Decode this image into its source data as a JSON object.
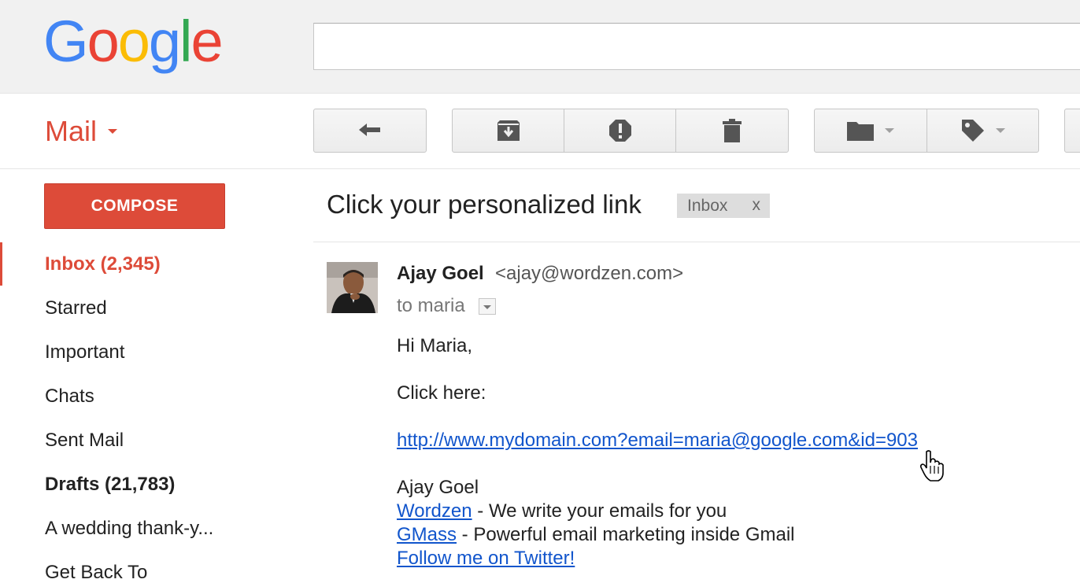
{
  "brand": {
    "logo_letters": [
      "G",
      "o",
      "o",
      "g",
      "l",
      "e"
    ],
    "logo_colors": [
      "#4285f4",
      "#ea4335",
      "#fbbc05",
      "#4285f4",
      "#34a853",
      "#ea4335"
    ],
    "accent": "#dd4b39",
    "link_color": "#1155cc"
  },
  "search": {
    "value": "",
    "placeholder": ""
  },
  "app_switcher": {
    "label": "Mail"
  },
  "toolbar": {
    "icons": [
      "reply-icon",
      "archive-icon",
      "report-spam-icon",
      "delete-icon",
      "move-to-folder-icon",
      "labels-icon"
    ]
  },
  "sidebar": {
    "compose_label": "COMPOSE",
    "items": [
      {
        "label": "Inbox (2,345)",
        "state": "active"
      },
      {
        "label": "Starred"
      },
      {
        "label": "Important"
      },
      {
        "label": "Chats"
      },
      {
        "label": "Sent Mail"
      },
      {
        "label": "Drafts (21,783)",
        "state": "bold"
      },
      {
        "label": "A wedding thank-y..."
      },
      {
        "label": "Get Back To"
      }
    ]
  },
  "thread": {
    "subject": "Click your personalized link",
    "label_chip": {
      "text": "Inbox",
      "remove": "x"
    }
  },
  "message": {
    "sender_name": "Ajay Goel",
    "sender_email": "<ajay@wordzen.com>",
    "to_line": "to maria",
    "body": {
      "greeting": "Hi Maria,",
      "instruction": "Click here:",
      "personalized_link": "http://www.mydomain.com?email=maria@google.com&id=903",
      "signature_name": "Ajay Goel",
      "sig_line1_link": "Wordzen",
      "sig_line1_text": " - We write your emails for you",
      "sig_line2_link": "GMass",
      "sig_line2_text": " - Powerful email marketing inside Gmail",
      "sig_line3_link": "Follow me on Twitter!"
    }
  }
}
